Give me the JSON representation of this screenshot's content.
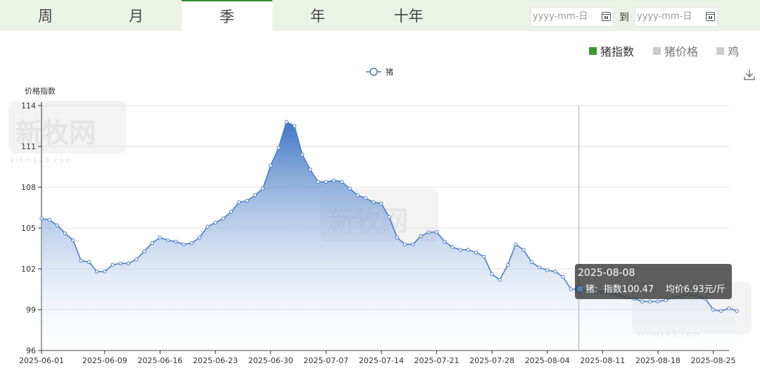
{
  "tabs": [
    {
      "label": "周",
      "active": false
    },
    {
      "label": "月",
      "active": false
    },
    {
      "label": "季",
      "active": true
    },
    {
      "label": "年",
      "active": false
    },
    {
      "label": "十年",
      "active": false
    }
  ],
  "date_range": {
    "start_placeholder": "yyyy-mm-日",
    "to_label": "到",
    "end_placeholder": "yyyy-mm-日"
  },
  "selectors": [
    {
      "label": "猪指数",
      "active": true,
      "color": "#3a9a2a"
    },
    {
      "label": "猪价格",
      "active": false,
      "color": "#cccccc"
    },
    {
      "label": "鸡",
      "active": false,
      "color": "#cccccc"
    }
  ],
  "watermark": {
    "text": "新牧网",
    "sub": "xinm123.com"
  },
  "tooltip": {
    "date": "2025-08-08",
    "series": "猪:",
    "index_text": "指数100.47",
    "price_text": "均价6.93元/斤"
  },
  "chart_data": {
    "type": "area",
    "ylabel": "价格指数",
    "legend": [
      "猪"
    ],
    "legend_position": "top-center",
    "grid": true,
    "ylim": [
      96,
      114
    ],
    "yticks": [
      96,
      99,
      102,
      105,
      108,
      111,
      114
    ],
    "xtick_labels": [
      "2025-06-01",
      "2025-06-09",
      "2025-06-16",
      "2025-06-23",
      "2025-06-30",
      "2025-07-07",
      "2025-07-14",
      "2025-07-21",
      "2025-07-28",
      "2025-08-04",
      "2025-08-11",
      "2025-08-18",
      "2025-08-25"
    ],
    "x_start": "2025-06-01",
    "x_end": "2025-08-27",
    "series": [
      {
        "name": "猪",
        "color": "#4a7fc7",
        "values": [
          105.7,
          105.6,
          105.2,
          104.6,
          104.1,
          102.6,
          102.5,
          101.8,
          101.8,
          102.3,
          102.4,
          102.4,
          102.7,
          103.3,
          103.9,
          104.3,
          104.1,
          104.0,
          103.8,
          103.9,
          104.3,
          105.1,
          105.4,
          105.7,
          106.2,
          106.9,
          107.0,
          107.4,
          107.9,
          109.6,
          110.9,
          112.8,
          112.5,
          110.4,
          109.3,
          108.4,
          108.4,
          108.5,
          108.4,
          107.9,
          107.4,
          107.2,
          106.9,
          106.8,
          105.8,
          104.3,
          103.8,
          103.8,
          104.4,
          104.7,
          104.7,
          104.0,
          103.6,
          103.4,
          103.4,
          103.2,
          102.9,
          101.6,
          101.2,
          102.3,
          103.8,
          103.4,
          102.5,
          102.1,
          101.9,
          101.8,
          101.4,
          100.5,
          100.5,
          100.4,
          100.4,
          100.3,
          100.2,
          100.1,
          99.9,
          99.8,
          99.6,
          99.6,
          99.6,
          99.7,
          99.9,
          100.0,
          100.1,
          100.0,
          99.8,
          99.0,
          98.9,
          99.1,
          98.9
        ]
      }
    ],
    "highlight_date": "2025-08-08"
  }
}
